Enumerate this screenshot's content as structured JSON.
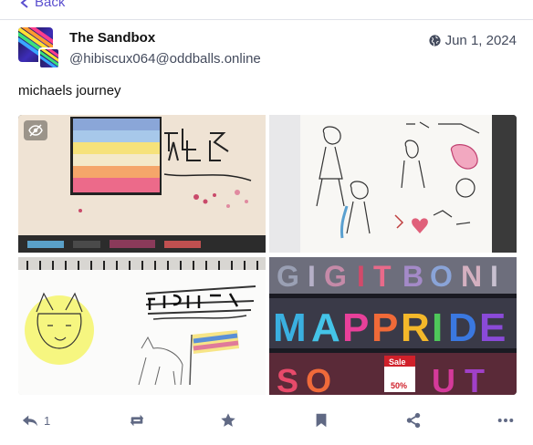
{
  "nav": {
    "back_label": "Back"
  },
  "post": {
    "display_name": "The Sandbox",
    "handle": "@hibiscux064@oddballs.online",
    "date": "Jun 1, 2024",
    "text": "michaels journey"
  },
  "actions": {
    "reply_count": "1"
  },
  "colors": {
    "accent": "#5a4fcf",
    "muted": "#606984"
  },
  "icons": [
    "chevron-left-icon",
    "globe-icon",
    "eye-slash-icon",
    "reply-icon",
    "boost-icon",
    "star-icon",
    "bookmark-icon",
    "share-icon",
    "more-icon"
  ],
  "images": [
    {
      "desc_name": "pride-flag-drawing"
    },
    {
      "desc_name": "sketchbook-characters"
    },
    {
      "desc_name": "freedom-cat-drawing"
    },
    {
      "desc_name": "pride-balloons"
    }
  ]
}
